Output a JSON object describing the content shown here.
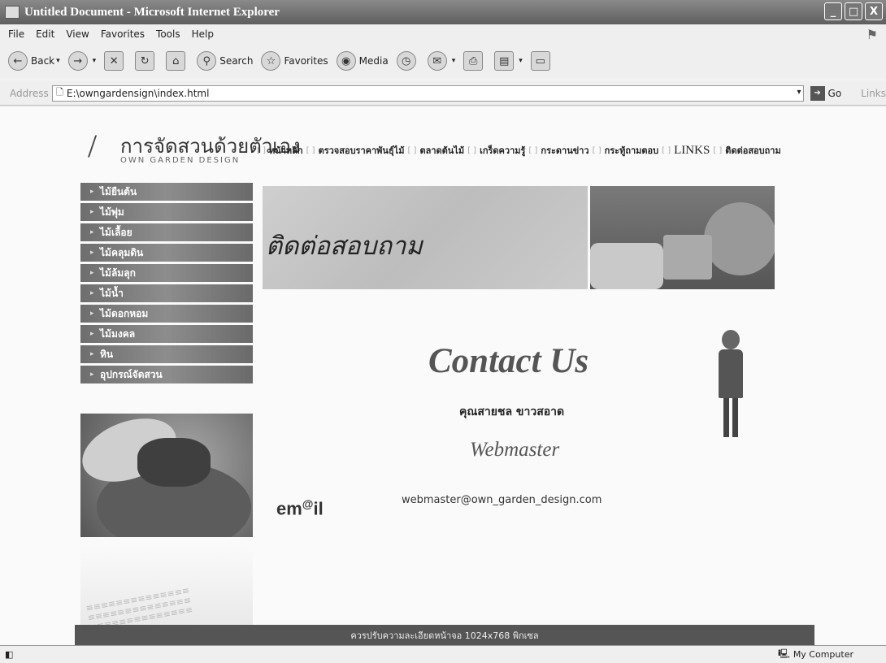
{
  "window": {
    "title": "Untitled Document - Microsoft Internet Explorer",
    "controls": [
      "_",
      "□",
      "X"
    ]
  },
  "menu": [
    "File",
    "Edit",
    "View",
    "Favorites",
    "Tools",
    "Help"
  ],
  "toolbar": {
    "back": "Back",
    "search": "Search",
    "favorites": "Favorites",
    "media": "Media"
  },
  "address": {
    "label": "Address",
    "url": "E:\\owngardensign\\index.html",
    "go": "Go",
    "links": "Links"
  },
  "site": {
    "logo_thai": "การจัดสวนด้วยตัวเอง",
    "logo_en": "OWN GARDEN DESIGN",
    "nav": [
      {
        "label": "หน้าหลัก",
        "big": false
      },
      {
        "label": "ตรวจสอบราคาพันธุ์ไม้",
        "big": false
      },
      {
        "label": "ตลาดต้นไม้",
        "big": false
      },
      {
        "label": "เกร็ดความรู้",
        "big": false
      },
      {
        "label": "กระดานข่าว",
        "big": false
      },
      {
        "label": "กระทู้ถามตอบ",
        "big": false
      },
      {
        "label": "LINKS",
        "big": true
      },
      {
        "label": "ติดต่อสอบถาม",
        "big": false
      }
    ],
    "sidebar": [
      "ไม้ยืนต้น",
      "ไม้พุ่ม",
      "ไม้เลื้อย",
      "ไม้คลุมดิน",
      "ไม้ล้มลุก",
      "ไม้น้ำ",
      "ไม้ดอกหอม",
      "ไม้มงคล",
      "หิน",
      "อุปกรณ์จัดสวน"
    ],
    "banner_title": "ติดต่อสอบถาม",
    "contact": {
      "heading": "Contact Us",
      "name": "คุณสายชล ขาวสอาด",
      "role": "Webmaster",
      "email_logo": "em",
      "email_logo_sup": "@",
      "email_logo_tail": "il",
      "email": "webmaster@own_garden_design.com"
    },
    "footer": "ควรปรับความละเอียดหน้าจอ 1024x768 พิกเซล"
  },
  "status": {
    "zone": "My Computer"
  }
}
